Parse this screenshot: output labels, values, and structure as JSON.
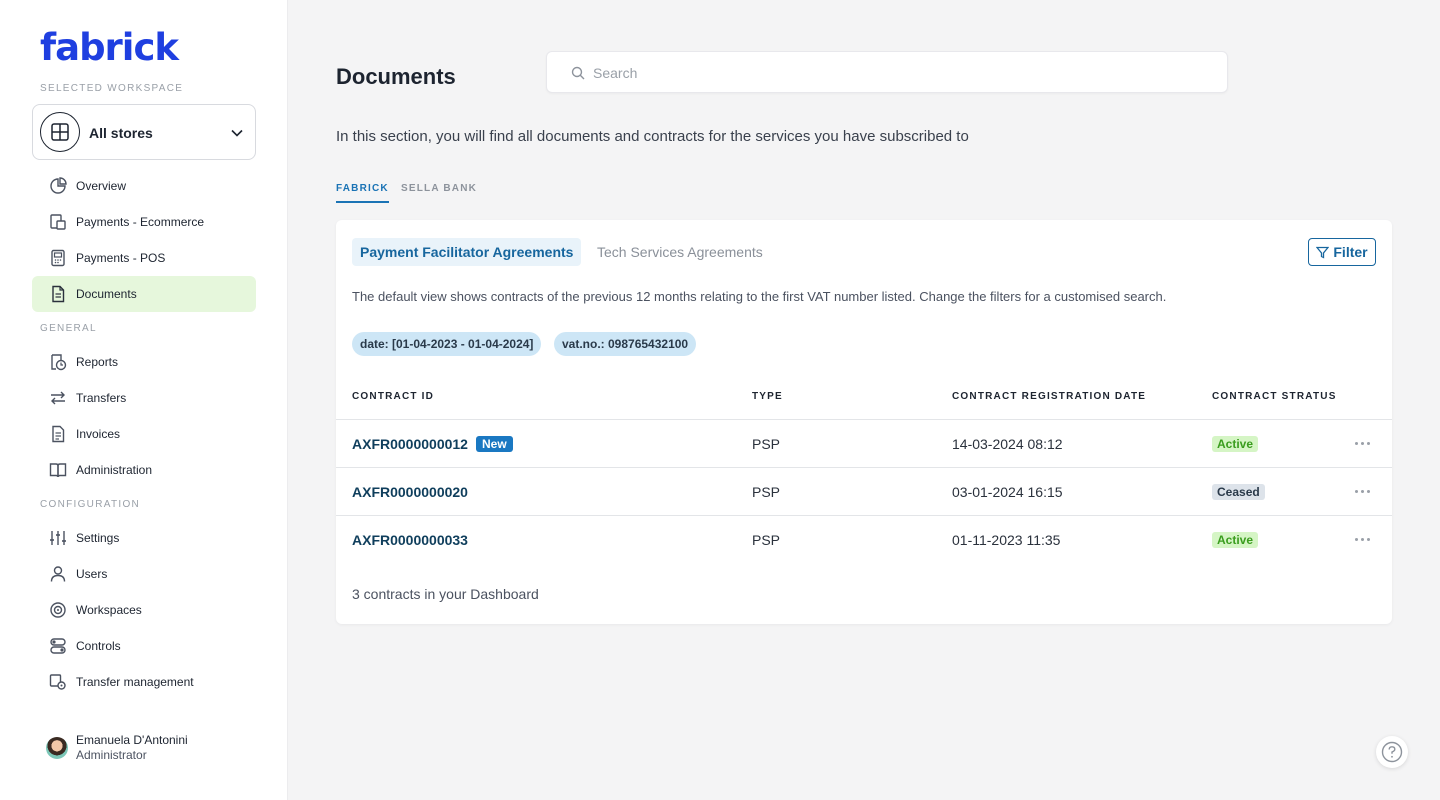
{
  "sidebar": {
    "logo": "fabrick",
    "workspace_label": "SELECTED WORKSPACE",
    "workspace_name": "All stores",
    "nav": [
      {
        "label": "Overview",
        "icon": "pie-chart-icon"
      },
      {
        "label": "Payments - Ecommerce",
        "icon": "ecommerce-payments-icon"
      },
      {
        "label": "Payments - POS",
        "icon": "pos-terminal-icon"
      },
      {
        "label": "Documents",
        "icon": "document-icon",
        "active": true
      }
    ],
    "general_label": "GENERAL",
    "general": [
      {
        "label": "Reports",
        "icon": "reports-icon"
      },
      {
        "label": "Transfers",
        "icon": "transfer-arrows-icon"
      },
      {
        "label": "Invoices",
        "icon": "invoice-icon"
      },
      {
        "label": "Administration",
        "icon": "book-icon"
      }
    ],
    "configuration_label": "CONFIGURATION",
    "configuration": [
      {
        "label": "Settings",
        "icon": "sliders-icon"
      },
      {
        "label": "Users",
        "icon": "user-icon"
      },
      {
        "label": "Workspaces",
        "icon": "workspaces-icon"
      },
      {
        "label": "Controls",
        "icon": "toggles-icon"
      },
      {
        "label": "Transfer management",
        "icon": "transfer-settings-icon"
      }
    ],
    "user": {
      "name": "Emanuela D'Antonini",
      "role": "Administrator"
    }
  },
  "main": {
    "title": "Documents",
    "search_placeholder": "Search",
    "intro": "In this section, you will find all documents and contracts for the services you have subscribed to",
    "tabs": [
      "FABRICK",
      "SELLA BANK"
    ],
    "active_tab": "FABRICK",
    "card": {
      "sub_tabs": [
        "Payment Facilitator Agreements",
        "Tech Services Agreements"
      ],
      "filter_label": "Filter",
      "description": "The default view shows contracts of the previous 12 months relating to the first VAT number listed. Change the filters for a customised search.",
      "chips": [
        "date: [01-04-2023 - 01-04-2024]",
        "vat.no.: 098765432100"
      ],
      "columns": [
        "CONTRACT ID",
        "TYPE",
        "CONTRACT REGISTRATION DATE",
        "CONTRACT STRATUS"
      ],
      "rows": [
        {
          "id": "AXFR0000000012",
          "badge": "New",
          "type": "PSP",
          "date": "14-03-2024 08:12",
          "status": "Active"
        },
        {
          "id": "AXFR0000000020",
          "badge": "",
          "type": "PSP",
          "date": "03-01-2024 16:15",
          "status": "Ceased"
        },
        {
          "id": "AXFR0000000033",
          "badge": "",
          "type": "PSP",
          "date": "01-11-2023 11:35",
          "status": "Active"
        }
      ],
      "footer": "3 contracts in your Dashboard"
    }
  },
  "colors": {
    "brand": "#1f3fe0",
    "accent": "#17669e",
    "active_nav_bg": "#e6f7dc",
    "status_active": "#3a9d1e",
    "status_ceased": "#2a3a4a"
  }
}
